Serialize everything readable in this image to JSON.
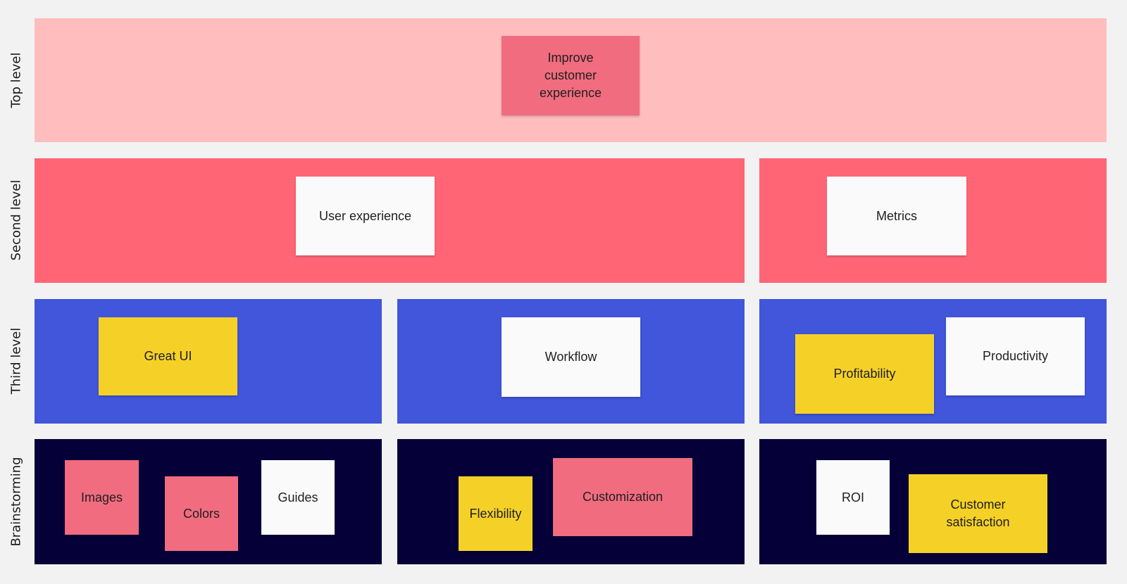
{
  "colors": {
    "background": "#f2f2f2",
    "top_level": "#ffbdbd",
    "second_level": "#ff6575",
    "third_level": "#4156db",
    "brainstorming": "#050038",
    "sticky_pink": "#f16c7f",
    "sticky_yellow": "#f5d128",
    "sticky_white": "#fafafa"
  },
  "row_labels": [
    "Top level",
    "Second level",
    "Third level",
    "Brainstorming"
  ],
  "stickies": {
    "improve": {
      "text": "Improve customer experience",
      "color": "pink"
    },
    "user_experience": {
      "text": "User experience",
      "color": "white"
    },
    "metrics": {
      "text": "Metrics",
      "color": "white"
    },
    "great_ui": {
      "text": "Great UI",
      "color": "yellow"
    },
    "workflow": {
      "text": "Workflow",
      "color": "white"
    },
    "profitability": {
      "text": "Profitability",
      "color": "yellow"
    },
    "productivity": {
      "text": "Productivity",
      "color": "white"
    },
    "images": {
      "text": "Images",
      "color": "pink"
    },
    "colors": {
      "text": "Colors",
      "color": "pink"
    },
    "guides": {
      "text": "Guides",
      "color": "white"
    },
    "flexibility": {
      "text": "Flexibility",
      "color": "yellow"
    },
    "customization": {
      "text": "Customization",
      "color": "pink"
    },
    "roi": {
      "text": "ROI",
      "color": "white"
    },
    "customer_satisfaction": {
      "text": "Customer satisfaction",
      "color": "yellow"
    }
  }
}
